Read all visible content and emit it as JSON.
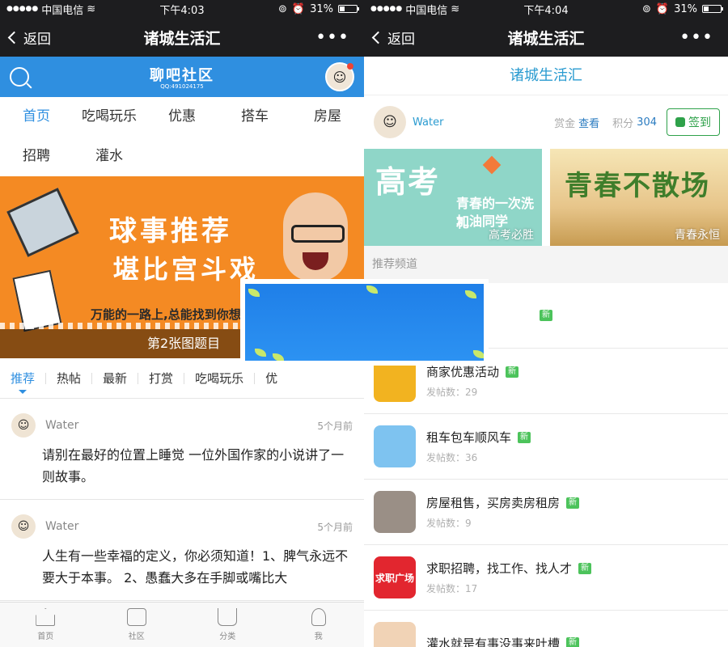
{
  "left": {
    "status": {
      "carrier": "中国电信",
      "time": "下午4:03",
      "battery": "31%"
    },
    "nav": {
      "back_label": "返回",
      "title": "诸城生活汇",
      "more": "•••"
    },
    "header": {
      "logo_text": "聊吧社区",
      "logo_qq": "QQ:491024175"
    },
    "categories": [
      {
        "label": "首页"
      },
      {
        "label": "吃喝玩乐"
      },
      {
        "label": "优惠"
      },
      {
        "label": "搭车"
      },
      {
        "label": "房屋"
      },
      {
        "label": "招聘"
      },
      {
        "label": "灌水"
      }
    ],
    "banner": {
      "line1": "球事推荐",
      "line2": "堪比宫斗戏",
      "line3": "万能的一路上,总能找到你想",
      "caption": "第2张图题目"
    },
    "subtabs": [
      {
        "label": "推荐"
      },
      {
        "label": "热帖"
      },
      {
        "label": "最新"
      },
      {
        "label": "打赏"
      },
      {
        "label": "吃喝玩乐"
      },
      {
        "label": "优"
      }
    ],
    "posts": [
      {
        "author": "Water",
        "time": "5个月前",
        "text": "请别在最好的位置上睡觉 一位外国作家的小说讲了一则故事。"
      },
      {
        "author": "Water",
        "time": "5个月前",
        "text": "人生有一些幸福的定义，你必须知道！1、脾气永远不要大于本事。 2、愚蠢大多在手脚或嘴比大"
      }
    ],
    "tabbar": [
      {
        "label": "首页"
      },
      {
        "label": "社区"
      },
      {
        "label": "分类"
      },
      {
        "label": "我"
      }
    ]
  },
  "right": {
    "status": {
      "carrier": "中国电信",
      "time": "下午4:04",
      "battery": "31%"
    },
    "nav": {
      "back_label": "返回",
      "title": "诸城生活汇",
      "more": "•••"
    },
    "page_title": "诸城生活汇",
    "user": {
      "name": "Water",
      "reward_label": "赏金",
      "reward_link": "查看",
      "points_label": "积分",
      "points_value": "304",
      "sign_label": "签到"
    },
    "banners": [
      {
        "title": "高考",
        "sub1": "青春的一次洗礼",
        "sub2": "加油同学",
        "caption": "高考必胜"
      },
      {
        "title": "青春不散场",
        "caption": "青春永恒"
      }
    ],
    "section_label": "推荐频道",
    "channels": [
      {
        "name": "商家优惠活动",
        "badge": "新",
        "count": "发帖数：29",
        "color": "#f2b320"
      },
      {
        "name": "租车包车顺风车",
        "badge": "新",
        "count": "发帖数：36",
        "color": "#7ec3f0"
      },
      {
        "name": "房屋租售，买房卖房租房",
        "badge": "新",
        "count": "发帖数：9",
        "color": "#9a8f86"
      },
      {
        "name": "求职招聘，找工作、找人才",
        "badge": "新",
        "count": "发帖数：17",
        "color": "#e2262f",
        "thumb_text": "求职广场"
      },
      {
        "name": "灌水就是有事没事来吐槽",
        "badge": "新",
        "count": "",
        "color": "#f1d3b6"
      }
    ],
    "first_channel_badge": "新"
  },
  "colors": {
    "accent_blue": "#2f8fe0",
    "title_teal": "#2a9bd0",
    "new_badge_green": "#4cc35b",
    "nav_black": "#1d1d1f"
  },
  "battery_level": 0.31
}
